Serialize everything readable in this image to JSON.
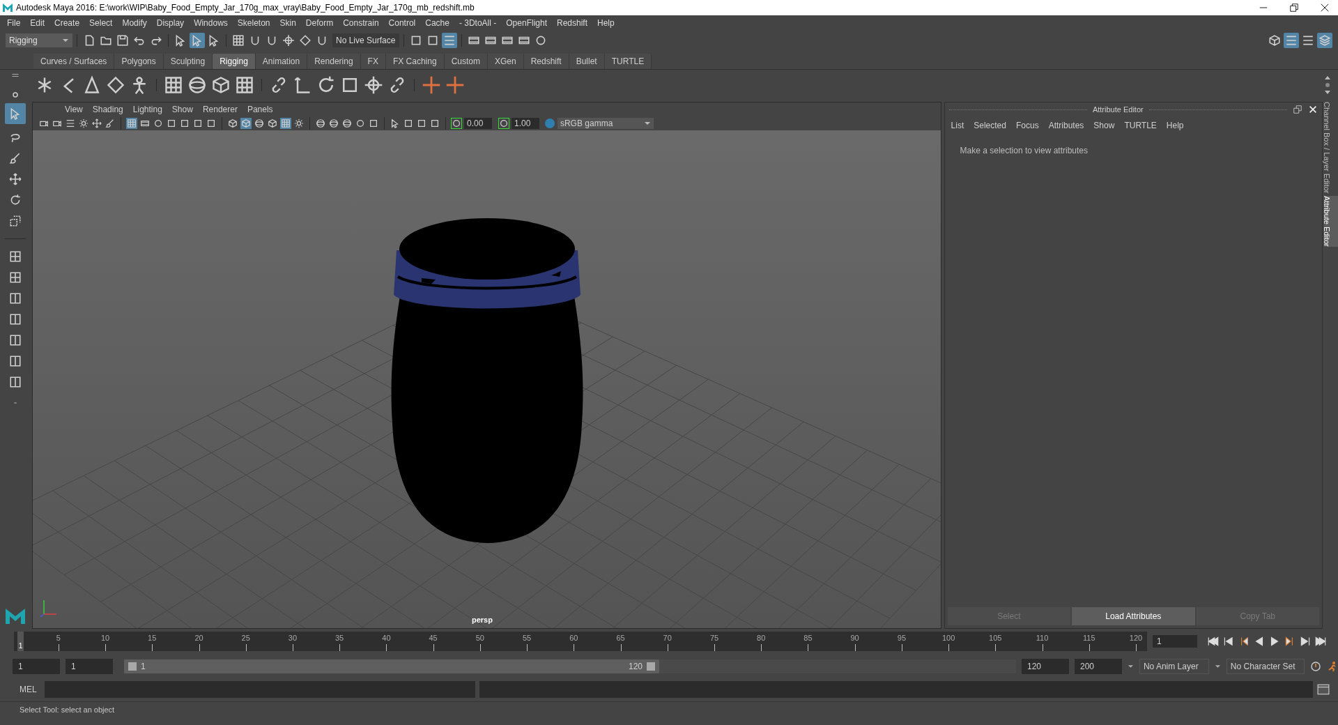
{
  "window": {
    "title": "Autodesk Maya 2016: E:\\work\\WIP\\Baby_Food_Empty_Jar_170g_max_vray\\Baby_Food_Empty_Jar_170g_mb_redshift.mb"
  },
  "menu_bar": [
    "File",
    "Edit",
    "Create",
    "Select",
    "Modify",
    "Display",
    "Windows",
    "Skeleton",
    "Skin",
    "Deform",
    "Constrain",
    "Control",
    "Cache",
    "- 3DtoAll -",
    "OpenFlight",
    "Redshift",
    "Help"
  ],
  "status_line": {
    "mode": "Rigging",
    "live_surface": "No Live Surface"
  },
  "shelf_tabs": [
    {
      "label": "Curves / Surfaces",
      "selected": false
    },
    {
      "label": "Polygons",
      "selected": false
    },
    {
      "label": "Sculpting",
      "selected": false
    },
    {
      "label": "Rigging",
      "selected": true
    },
    {
      "label": "Animation",
      "selected": false
    },
    {
      "label": "Rendering",
      "selected": false
    },
    {
      "label": "FX",
      "selected": false
    },
    {
      "label": "FX Caching",
      "selected": false
    },
    {
      "label": "Custom",
      "selected": false
    },
    {
      "label": "XGen",
      "selected": false
    },
    {
      "label": "Redshift",
      "selected": false
    },
    {
      "label": "Bullet",
      "selected": false
    },
    {
      "label": "TURTLE",
      "selected": false
    }
  ],
  "viewport": {
    "menu": [
      "View",
      "Shading",
      "Lighting",
      "Show",
      "Renderer",
      "Panels"
    ],
    "exposure": "0.00",
    "gamma": "1.00",
    "color_space": "sRGB gamma",
    "camera": "persp"
  },
  "attribute_editor": {
    "title": "Attribute Editor",
    "menu": [
      "List",
      "Selected",
      "Focus",
      "Attributes",
      "Show",
      "TURTLE",
      "Help"
    ],
    "message": "Make a selection to view attributes",
    "buttons": [
      {
        "label": "Select",
        "disabled": true
      },
      {
        "label": "Load Attributes",
        "disabled": false
      },
      {
        "label": "Copy Tab",
        "disabled": true
      }
    ]
  },
  "side_tabs": [
    {
      "label": "Channel Box / Layer Editor",
      "selected": false
    },
    {
      "label": "Attribute Editor",
      "selected": true
    }
  ],
  "time_slider": {
    "playhead": "1",
    "ticks": [
      "5",
      "10",
      "15",
      "20",
      "25",
      "30",
      "35",
      "40",
      "45",
      "50",
      "55",
      "60",
      "65",
      "70",
      "75",
      "80",
      "85",
      "90",
      "95",
      "100",
      "105",
      "110",
      "115",
      "120"
    ],
    "current_frame": "1"
  },
  "range_slider": {
    "level": 0.6,
    "start_time": "1",
    "playback_start": "1",
    "range_start": "1",
    "range_end": "120",
    "playback_end": "120",
    "end_time": "200",
    "anim_layer": "No Anim Layer",
    "character_set": "No Character Set"
  },
  "command_line": {
    "label": "MEL"
  },
  "help_line": "Select Tool: select an object"
}
